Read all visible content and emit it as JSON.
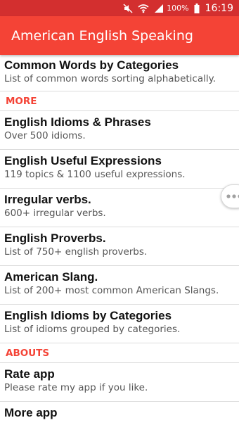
{
  "status_bar": {
    "battery": "100%",
    "time": "16:19"
  },
  "app_bar": {
    "title": "American English Speaking"
  },
  "items_top": [
    {
      "title": "Common Words by Categories",
      "subtitle": "List of common words sorting alphabetically."
    }
  ],
  "sections": {
    "more": "MORE",
    "abouts": "ABOUTS"
  },
  "more_items": [
    {
      "title": "English Idioms & Phrases",
      "subtitle": "Over 500 idioms."
    },
    {
      "title": "English Useful Expressions",
      "subtitle": "119 topics & 1100 useful expressions."
    },
    {
      "title": "Irregular verbs.",
      "subtitle": "600+ irregular verbs."
    },
    {
      "title": "English Proverbs.",
      "subtitle": "List of 750+ english proverbs."
    },
    {
      "title": "American Slang.",
      "subtitle": "List of 200+ most common American Slangs."
    },
    {
      "title": "English Idioms by Categories",
      "subtitle": "List of idioms grouped by categories."
    }
  ],
  "about_items": [
    {
      "title": "Rate app",
      "subtitle": "Please rate my app if you like."
    },
    {
      "title": "More app",
      "subtitle": ""
    }
  ],
  "icons": {
    "mute": "mute-icon",
    "wifi": "wifi-icon",
    "signal": "signal-icon",
    "battery": "battery-icon",
    "more": "more-dots-icon"
  },
  "colors": {
    "status_bar": "#d32f2f",
    "app_bar": "#f44336",
    "section_label": "#f44336"
  }
}
